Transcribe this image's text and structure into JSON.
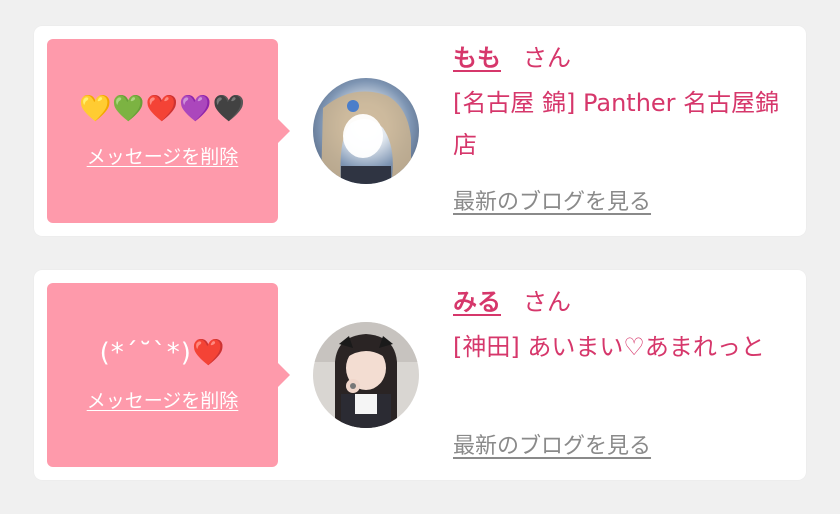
{
  "messages": [
    {
      "text": "💛💚❤️💜🖤",
      "delete_label": "メッセージを削除",
      "name": "もも",
      "honorific": "さん",
      "shop": "[名古屋 錦] Panther 名古屋錦店",
      "blog_label": "最新のブログを見る"
    },
    {
      "text": "(*´˘`*)❤️",
      "delete_label": "メッセージを削除",
      "name": "みる",
      "honorific": "さん",
      "shop": "[神田] あいまい♡あまれっと",
      "blog_label": "最新のブログを見る"
    }
  ],
  "colors": {
    "bubble": "#fe9aab",
    "accent": "#d6376b",
    "link_gray": "#8a8a8a",
    "background": "#f0f0f0"
  }
}
